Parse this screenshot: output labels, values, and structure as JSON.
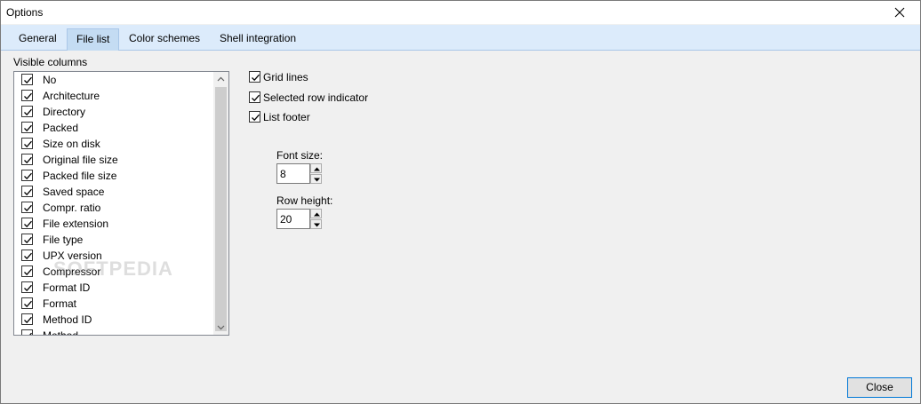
{
  "window": {
    "title": "Options"
  },
  "tabs": [
    {
      "label": "General"
    },
    {
      "label": "File list"
    },
    {
      "label": "Color schemes"
    },
    {
      "label": "Shell integration"
    }
  ],
  "visible_columns": {
    "label": "Visible columns",
    "items": [
      {
        "label": "No",
        "checked": true
      },
      {
        "label": "Architecture",
        "checked": true
      },
      {
        "label": "Directory",
        "checked": true
      },
      {
        "label": "Packed",
        "checked": true
      },
      {
        "label": "Size on disk",
        "checked": true
      },
      {
        "label": "Original file size",
        "checked": true
      },
      {
        "label": "Packed file size",
        "checked": true
      },
      {
        "label": "Saved space",
        "checked": true
      },
      {
        "label": "Compr. ratio",
        "checked": true
      },
      {
        "label": "File extension",
        "checked": true
      },
      {
        "label": "File type",
        "checked": true
      },
      {
        "label": "UPX version",
        "checked": true
      },
      {
        "label": "Compressor",
        "checked": true
      },
      {
        "label": "Format ID",
        "checked": true
      },
      {
        "label": "Format",
        "checked": true
      },
      {
        "label": "Method ID",
        "checked": true
      },
      {
        "label": "Method",
        "checked": true
      }
    ]
  },
  "options": {
    "grid_lines": {
      "label": "Grid lines",
      "checked": true
    },
    "selected_row_indicator": {
      "label": "Selected row indicator",
      "checked": true
    },
    "list_footer": {
      "label": "List footer",
      "checked": true
    }
  },
  "font_size": {
    "label": "Font size:",
    "value": "8"
  },
  "row_height": {
    "label": "Row height:",
    "value": "20"
  },
  "watermark": "SOFTPEDIA",
  "footer": {
    "close_label": "Close"
  },
  "colors": {
    "tab_bar": "#dcebfb",
    "active_tab": "#c4dcf3",
    "accent": "#0078d7"
  }
}
